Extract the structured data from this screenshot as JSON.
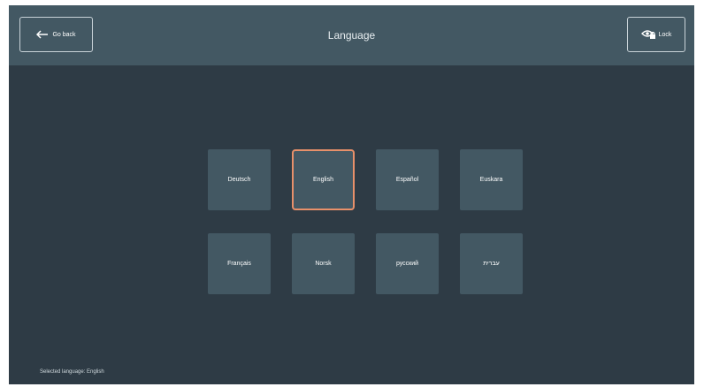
{
  "header": {
    "title": "Language",
    "back_button": {
      "label": "Go back",
      "icon": "arrow-left-icon"
    },
    "lock_button": {
      "label": "Lock",
      "icon": "eye-lock-icon"
    }
  },
  "languages": [
    {
      "label": "Deutsch",
      "selected": false
    },
    {
      "label": "English",
      "selected": true
    },
    {
      "label": "Español",
      "selected": false
    },
    {
      "label": "Euskara",
      "selected": false
    },
    {
      "label": "Français",
      "selected": false
    },
    {
      "label": "Norsk",
      "selected": false
    },
    {
      "label": "русский",
      "selected": false
    },
    {
      "label": "עברית",
      "selected": false
    }
  ],
  "status": {
    "text": "Selected language: English"
  },
  "colors": {
    "background": "#2e3b45",
    "header": "#435863",
    "tile": "#435863",
    "selected_border": "#e8906a"
  }
}
